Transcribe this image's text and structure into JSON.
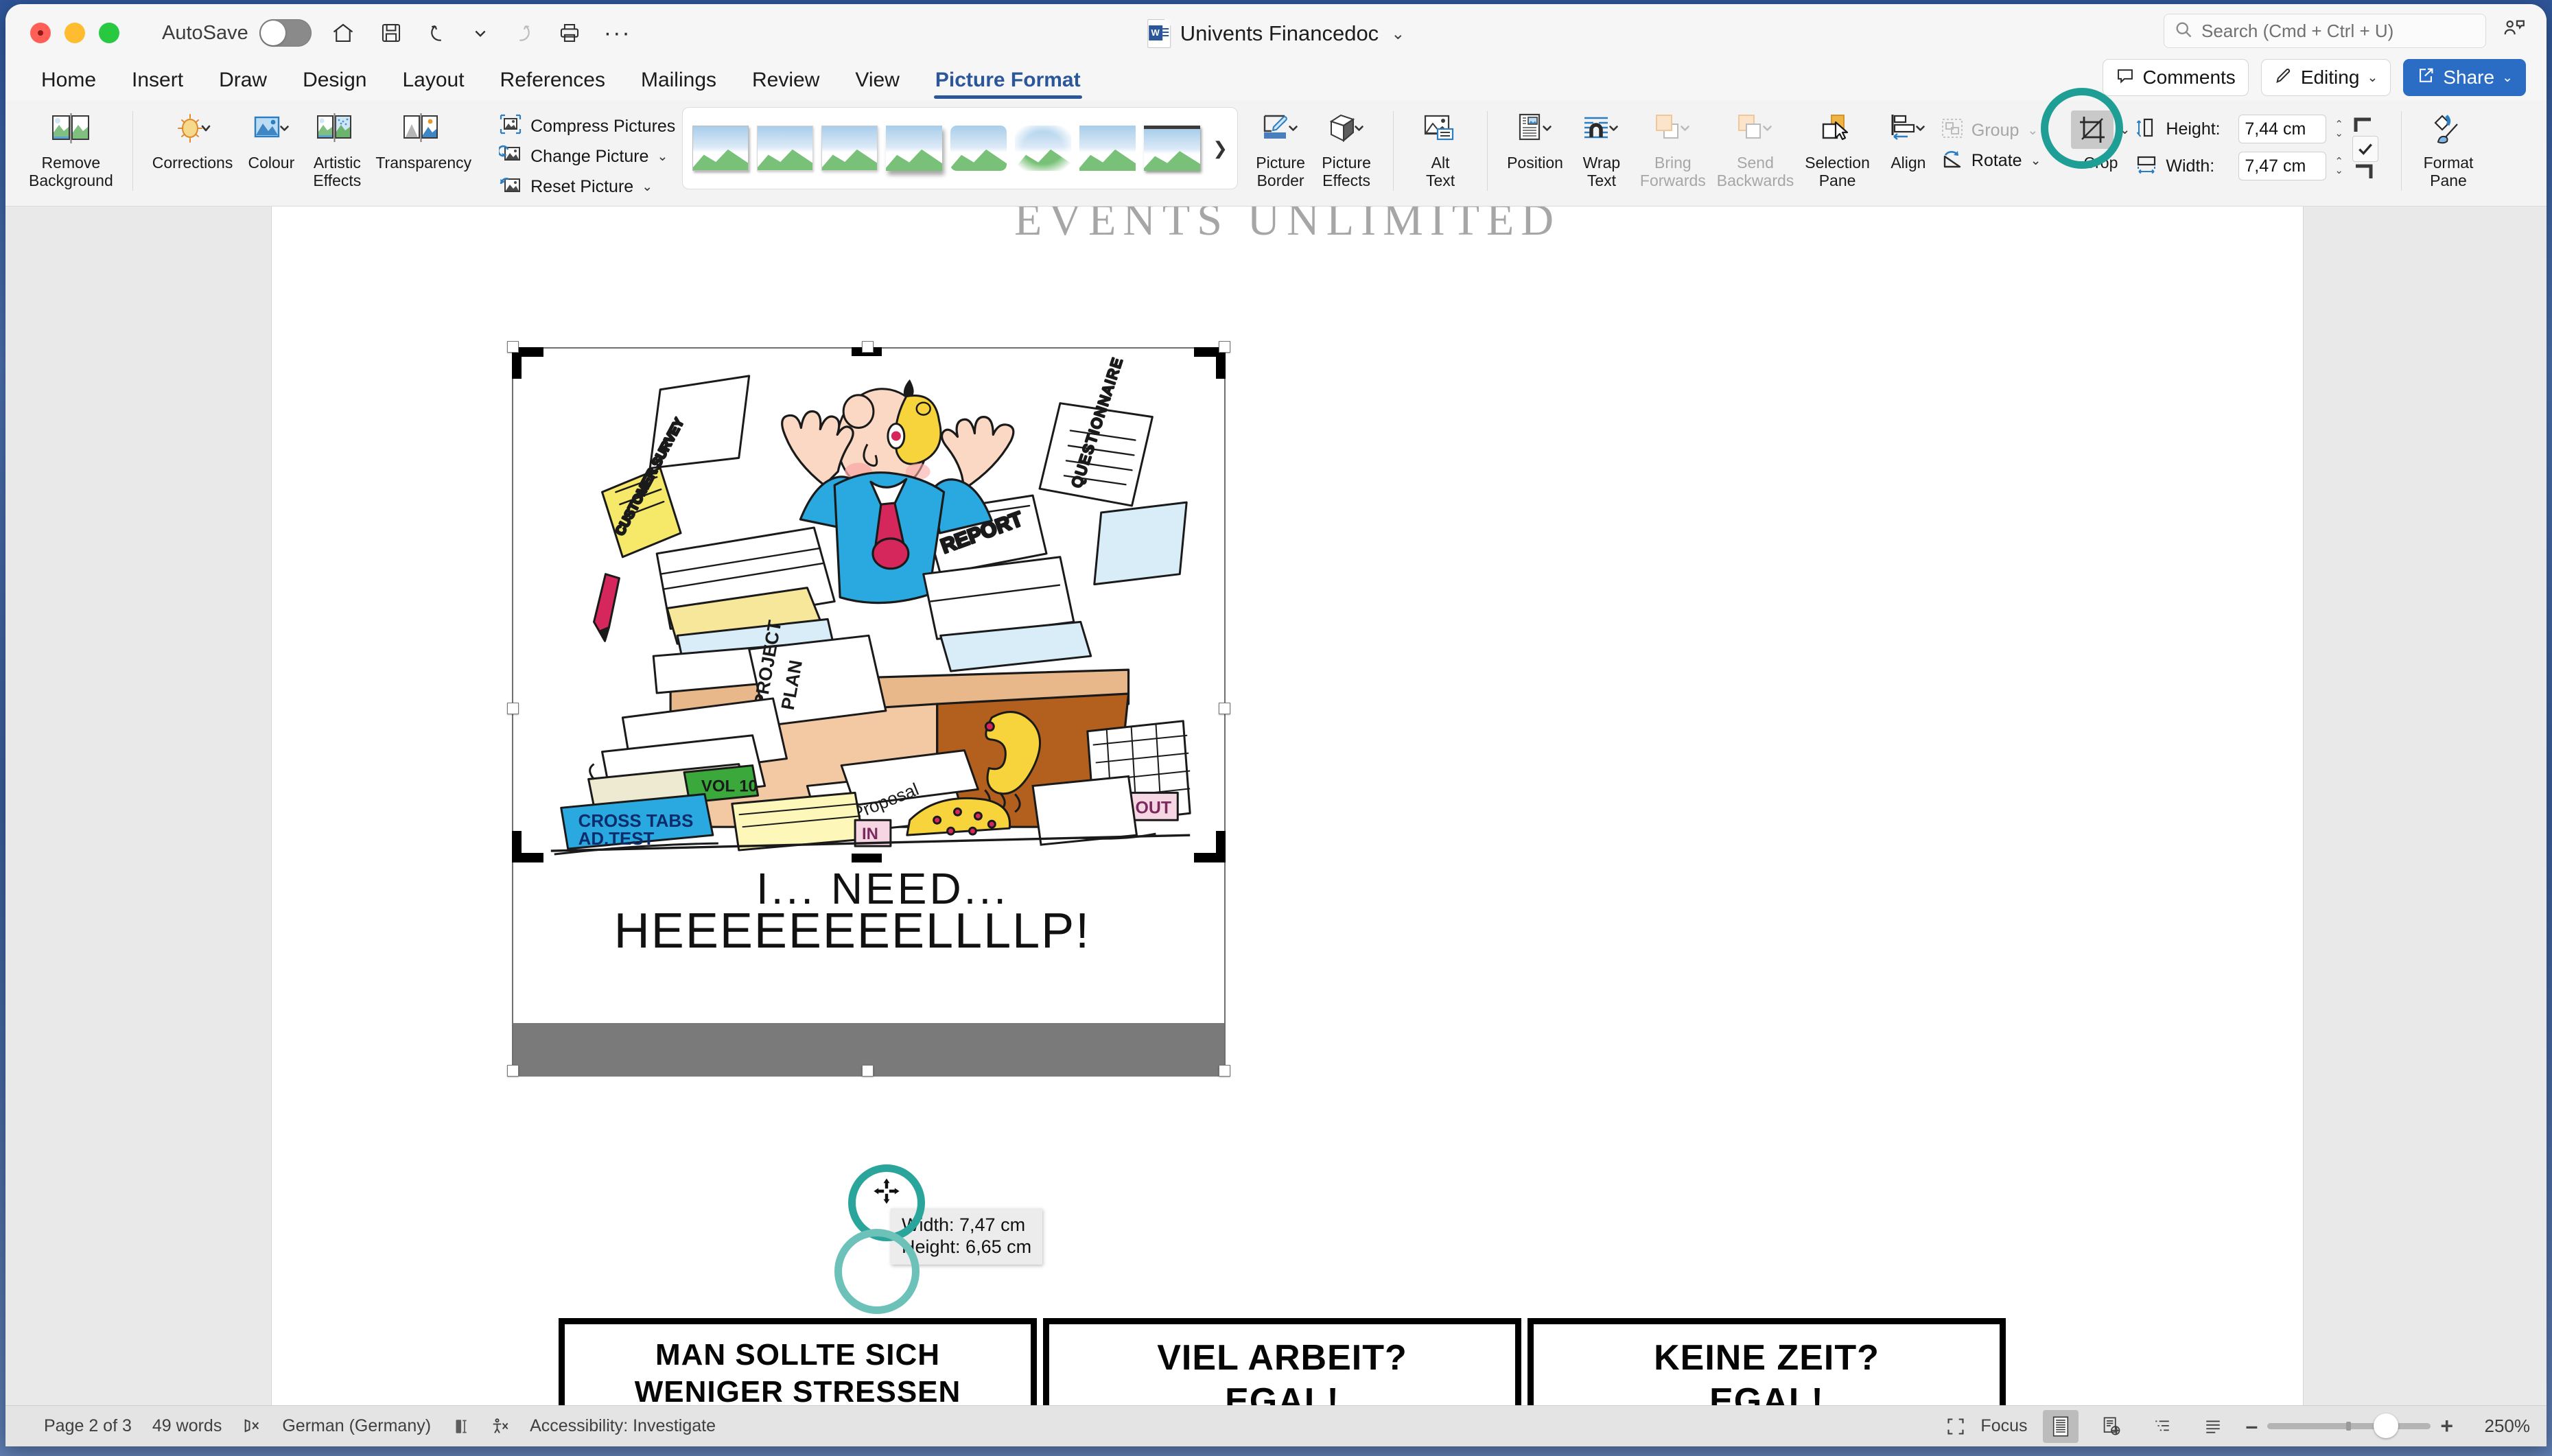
{
  "window": {
    "traffic_lights": [
      "close",
      "minimize",
      "zoom"
    ],
    "autosave_label": "AutoSave",
    "autosave_state": "off",
    "quick_access": [
      "home-icon",
      "save-icon",
      "undo-icon",
      "undo-dropdown-icon",
      "redo-icon",
      "print-icon",
      "more-icon"
    ],
    "document_title": "Univents Financedoc",
    "title_caret": "⌄"
  },
  "search": {
    "placeholder": "Search (Cmd + Ctrl + U)",
    "icon": "search-icon"
  },
  "header_actions": {
    "comments": "Comments",
    "editing": "Editing",
    "editing_caret": "⌄",
    "share": "Share",
    "share_caret": "⌄",
    "collab_icon": "collaborators-icon"
  },
  "tabs": [
    {
      "label": "Home",
      "active": false
    },
    {
      "label": "Insert",
      "active": false
    },
    {
      "label": "Draw",
      "active": false
    },
    {
      "label": "Design",
      "active": false
    },
    {
      "label": "Layout",
      "active": false
    },
    {
      "label": "References",
      "active": false
    },
    {
      "label": "Mailings",
      "active": false
    },
    {
      "label": "Review",
      "active": false
    },
    {
      "label": "View",
      "active": false
    },
    {
      "label": "Picture Format",
      "active": true
    }
  ],
  "ribbon": {
    "remove_background": "Remove\nBackground",
    "corrections": "Corrections",
    "colour": "Colour",
    "artistic_effects": "Artistic\nEffects",
    "transparency": "Transparency",
    "compress_pictures": "Compress Pictures",
    "change_picture": "Change Picture",
    "reset_picture": "Reset Picture",
    "gallery_more": "❯",
    "picture_border": "Picture\nBorder",
    "picture_effects": "Picture\nEffects",
    "alt_text": "Alt\nText",
    "position": "Position",
    "wrap_text": "Wrap\nText",
    "bring_forwards": "Bring\nForwards",
    "send_backwards": "Send\nBackwards",
    "selection_pane": "Selection\nPane",
    "align": "Align",
    "group": "Group",
    "rotate": "Rotate",
    "crop": "Crop",
    "height_label": "Height:",
    "height_value": "7,44 cm",
    "width_label": "Width:",
    "width_value": "7,47 cm",
    "format_pane": "Format\nPane",
    "highlight_color": "#1f9e96"
  },
  "document": {
    "heading": "EVENTS UNLIMITED",
    "caption_line1": "I... NEED...",
    "caption_line2": "HEEEEEEEELLLLP!",
    "comic_boxes": [
      "MAN SOLLTE SICH\nWENIGER STRESSEN",
      "VIEL ARBEIT?\nEGAL!",
      "KEINE ZEIT?\nEGAL!"
    ],
    "size_tooltip": {
      "width": "Width: 7,47 cm",
      "height": "Height: 6,65 cm"
    }
  },
  "statusbar": {
    "page": "Page 2 of 3",
    "words": "49 words",
    "proofing_icon": "spelling-icon",
    "language": "German (Germany)",
    "track_changes_icon": "track-changes-icon",
    "accessibility_icon": "accessibility-icon",
    "accessibility": "Accessibility: Investigate",
    "focus": "Focus",
    "views": [
      "print-layout-view",
      "web-layout-view",
      "outline-view",
      "draft-view"
    ],
    "zoom_minus": "–",
    "zoom_plus": "+",
    "zoom_value": "250%"
  }
}
